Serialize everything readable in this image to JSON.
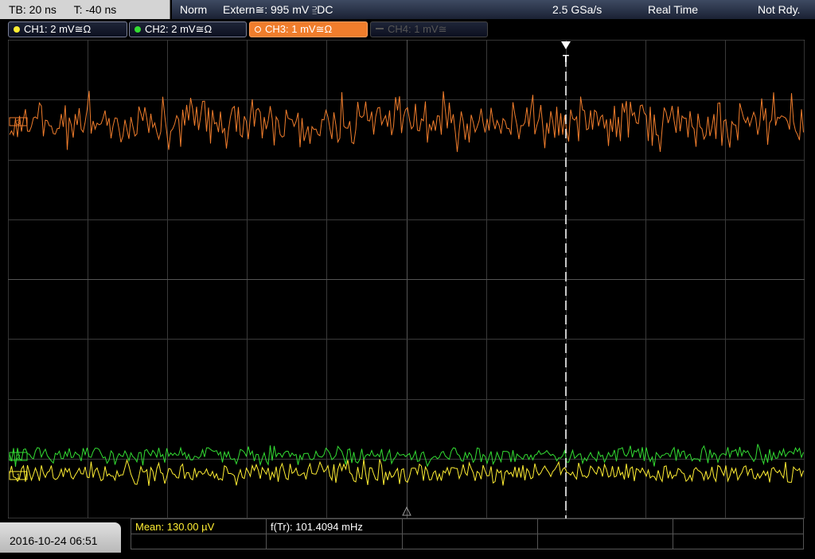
{
  "topbar": {
    "timebase": "TB: 20 ns",
    "trigger_time": "T: -40 ns",
    "mode": "Norm",
    "trigger_source": "Extern≅: 995 mV ⫆DC",
    "sample_rate": "2.5 GSa/s",
    "acq_mode": "Real Time",
    "status": "Not Rdy."
  },
  "channels": [
    {
      "label": "CH1: 2 mV≅Ω",
      "color": "#ffee33",
      "state": "on"
    },
    {
      "label": "CH2: 2 mV≅Ω",
      "color": "#33dd33",
      "state": "on"
    },
    {
      "label": "CH3: 1 mV≅Ω",
      "color": "#f07d2c",
      "state": "active"
    },
    {
      "label": "CH4: 1 mV≅",
      "color": "#555555",
      "state": "off"
    }
  ],
  "markers": {
    "trigger": "T",
    "ch1_ref": "1",
    "ch2_ref": "2",
    "ch3_ref": "3"
  },
  "measurements": {
    "mean": "Mean: 130.00 µV",
    "freq": "f(Tr): 101.4094 mHz"
  },
  "datetime": "2016-10-24 06:51",
  "colors": {
    "ch1": "#ffee33",
    "ch2": "#33dd33",
    "ch3": "#f07d2c",
    "grid": "#3a3a3a"
  },
  "chart_data": {
    "type": "line",
    "grid": true,
    "divisions": {
      "x": 10,
      "y": 8
    },
    "series": [
      {
        "name": "CH3",
        "color": "#f07d2c"
      },
      {
        "name": "CH2",
        "color": "#33dd33"
      },
      {
        "name": "CH1",
        "color": "#ffee33"
      }
    ]
  }
}
